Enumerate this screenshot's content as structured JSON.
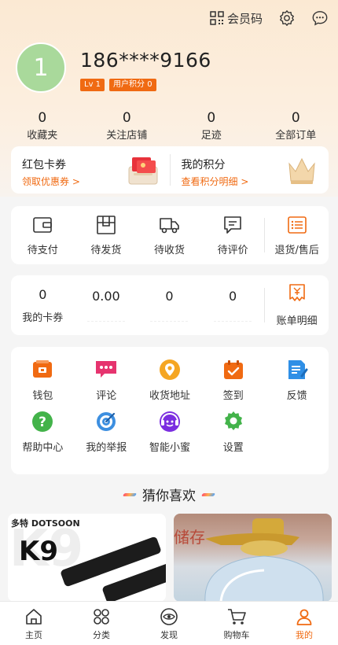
{
  "header": {
    "member_code_label": "会员码",
    "settings_icon": "gear-icon",
    "message_icon": "chat-bubble-icon"
  },
  "profile": {
    "avatar_text": "1",
    "phone": "186****9166",
    "level_badge": "Lv 1",
    "points_badge": "用户积分 0"
  },
  "stats": [
    {
      "value": "0",
      "label": "收藏夹"
    },
    {
      "value": "0",
      "label": "关注店铺"
    },
    {
      "value": "0",
      "label": "足迹"
    },
    {
      "value": "0",
      "label": "全部订单"
    }
  ],
  "promo": {
    "coupon_title": "红包卡券",
    "coupon_link": "领取优惠券 >",
    "points_title": "我的积分",
    "points_link": "查看积分明细 >"
  },
  "orders": [
    {
      "label": "待支付",
      "icon": "wallet-icon"
    },
    {
      "label": "待发货",
      "icon": "box-icon"
    },
    {
      "label": "待收货",
      "icon": "truck-icon"
    },
    {
      "label": "待评价",
      "icon": "comment-icon"
    },
    {
      "label": "退货/售后",
      "icon": "list-icon"
    }
  ],
  "money": [
    {
      "value": "0",
      "label": "我的卡券"
    },
    {
      "value": "0.00",
      "label": ""
    },
    {
      "value": "0",
      "label": ""
    },
    {
      "value": "0",
      "label": ""
    },
    {
      "value": "",
      "label": "账单明细",
      "icon": "bill-icon"
    }
  ],
  "services": [
    {
      "label": "钱包",
      "icon": "wallet-icon"
    },
    {
      "label": "评论",
      "icon": "comment-icon"
    },
    {
      "label": "收货地址",
      "icon": "location-icon"
    },
    {
      "label": "签到",
      "icon": "calendar-icon"
    },
    {
      "label": "反馈",
      "icon": "feedback-icon"
    },
    {
      "label": "帮助中心",
      "icon": "help-icon"
    },
    {
      "label": "我的举报",
      "icon": "target-icon"
    },
    {
      "label": "智能小蜜",
      "icon": "assistant-icon"
    },
    {
      "label": "设置",
      "icon": "gear-icon"
    }
  ],
  "recommend": {
    "title": "猜你喜欢",
    "product1_brand": "多特 DOTSOON",
    "product1_model": "K9",
    "product2_text": "储存"
  },
  "tabbar": [
    {
      "label": "主页",
      "icon": "home-icon"
    },
    {
      "label": "分类",
      "icon": "category-icon"
    },
    {
      "label": "发现",
      "icon": "eye-icon"
    },
    {
      "label": "购物车",
      "icon": "cart-icon"
    },
    {
      "label": "我的",
      "icon": "user-icon",
      "active": true
    }
  ],
  "colors": {
    "accent": "#f06a12",
    "hero_bg": "#fbe9d3",
    "avatar_bg": "#a9d99b"
  }
}
